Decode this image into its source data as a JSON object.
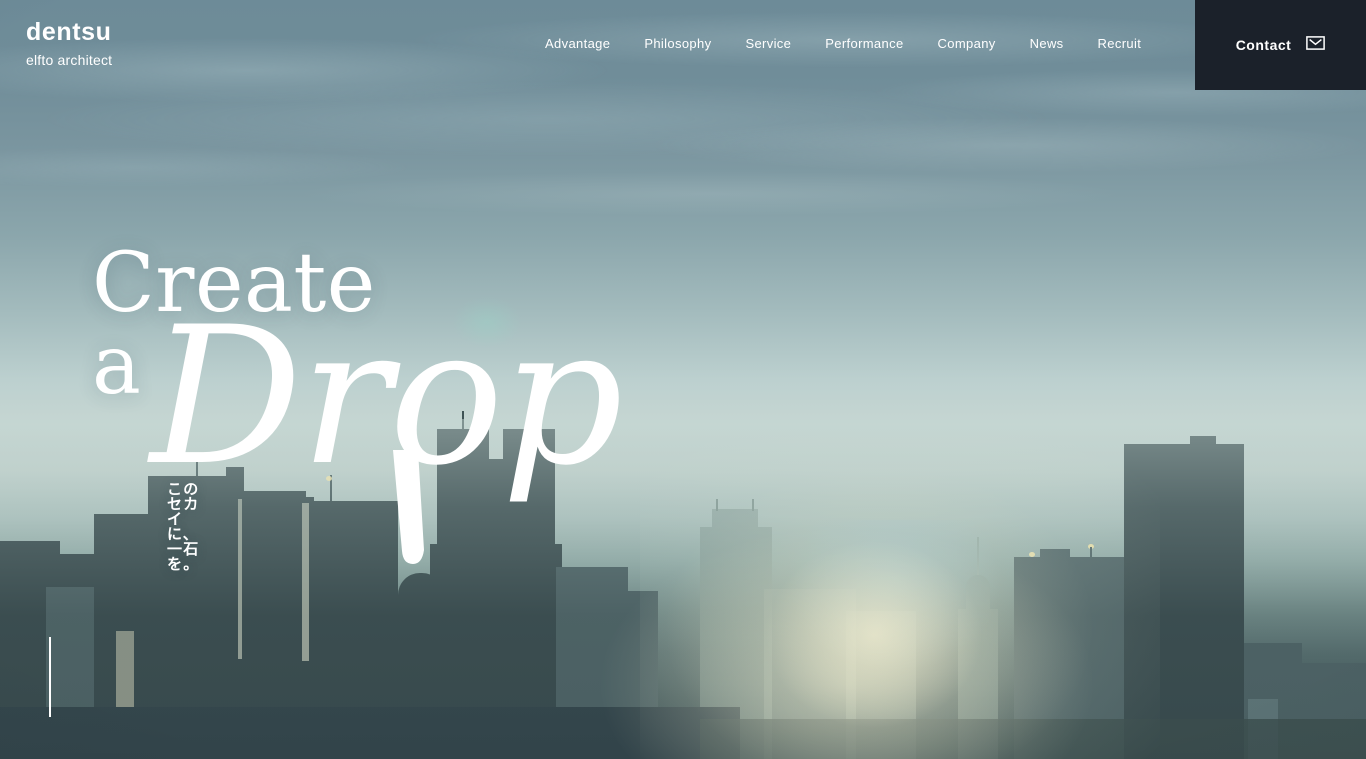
{
  "header": {
    "logo": {
      "main": "dentsu",
      "sub": "elfto architect",
      "name": "dentsu elfto architect"
    },
    "nav": [
      {
        "label": "Advantage"
      },
      {
        "label": "Philosophy"
      },
      {
        "label": "Service"
      },
      {
        "label": "Performance"
      },
      {
        "label": "Company"
      },
      {
        "label": "News"
      },
      {
        "label": "Recruit"
      }
    ],
    "contact": {
      "label": "Contact",
      "icon": "mail-icon",
      "background": "#1b212a"
    }
  },
  "hero": {
    "headline_line1": "Create a",
    "headline_line2": "Drop",
    "tagline": "このセカイに、一石を。",
    "scroll_indicator": "scroll-line",
    "colors": {
      "sky_top": "#6d8b98",
      "sky_mid": "#bcd0cf",
      "ground": "#384e51",
      "building": "#3f5355",
      "text": "#ffffff",
      "contact_bg": "#1b212a",
      "sun_flare": "#fff6d6"
    }
  }
}
